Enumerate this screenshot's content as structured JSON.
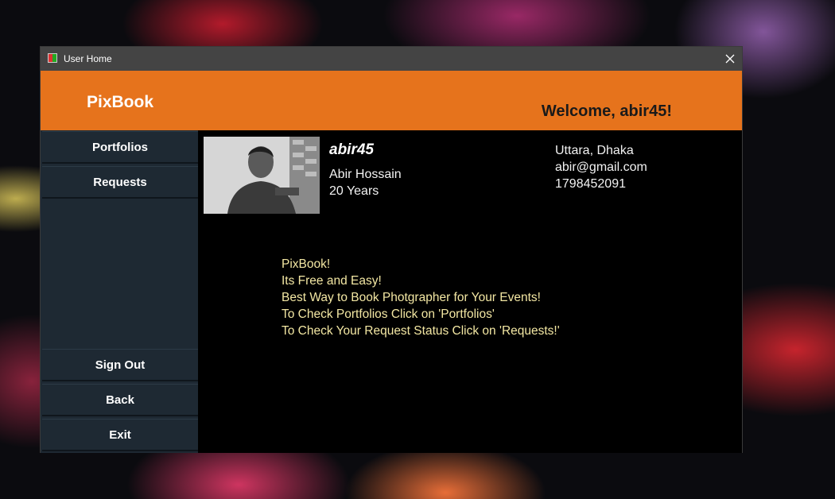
{
  "window": {
    "title": "User Home",
    "close_label": "✕"
  },
  "header": {
    "logo": "PixBook",
    "welcome": "Welcome, abir45!",
    "accent_color": "#e6731c"
  },
  "sidebar": {
    "top_items": [
      {
        "label": "Portfolios"
      },
      {
        "label": "Requests"
      }
    ],
    "bottom_items": [
      {
        "label": "Sign Out"
      },
      {
        "label": "Back"
      },
      {
        "label": "Exit"
      }
    ]
  },
  "profile": {
    "username": "abir45",
    "full_name": "Abir Hossain",
    "age": "20 Years",
    "location": "Uttara, Dhaka",
    "email": "abir@gmail.com",
    "phone": "1798452091"
  },
  "messages": [
    "PixBook!",
    "Its Free and Easy!",
    "Best Way to Book Photgrapher for Your Events!",
    "To Check Portfolios Click on 'Portfolios'",
    "To Check Your Request Status Click on 'Requests!'"
  ]
}
